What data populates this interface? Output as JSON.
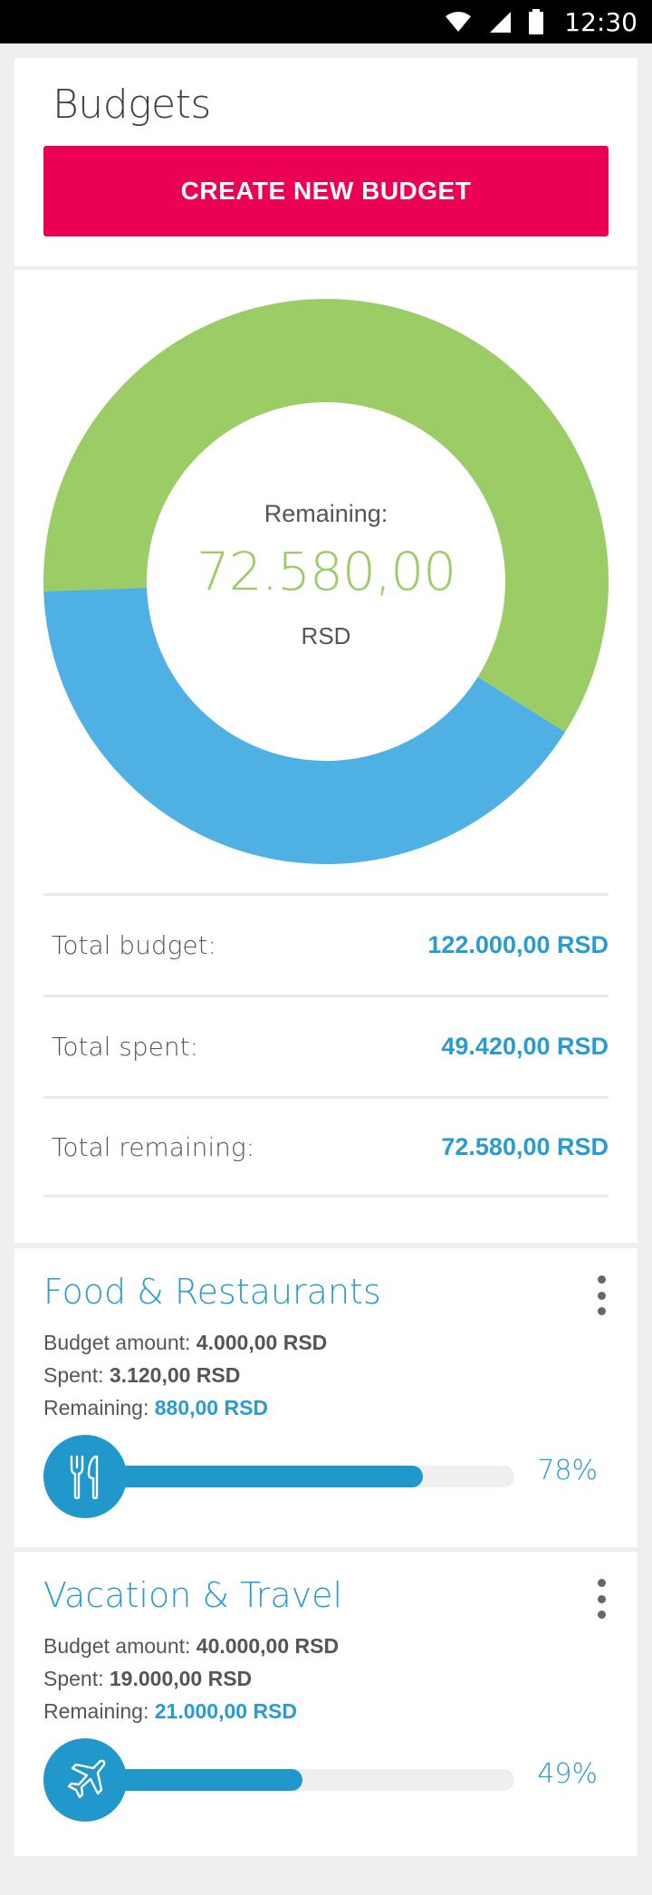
{
  "status_bar": {
    "time": "12:30",
    "icons": [
      "wifi-icon",
      "signal-icon",
      "battery-icon"
    ]
  },
  "page": {
    "title": "Budgets",
    "create_button": "CREATE NEW BUDGET"
  },
  "colors": {
    "accent": "#ec0055",
    "blue": "#2a9bd0",
    "green": "#9ccc65",
    "chart_blue": "#4fb0e3"
  },
  "chart_data": {
    "type": "pie",
    "series": [
      {
        "name": "",
        "value": 72580,
        "color": "#9ccc65"
      },
      {
        "name": "",
        "value": 49420,
        "color": "#4fb0e3"
      }
    ],
    "center": {
      "label": "Remaining:",
      "value": "72.580,00",
      "unit": "RSD"
    }
  },
  "totals": [
    {
      "label": "Total budget:",
      "value": "122.000,00 RSD"
    },
    {
      "label": "Total spent:",
      "value": "49.420,00 RSD"
    },
    {
      "label": "Total remaining:",
      "value": "72.580,00 RSD"
    }
  ],
  "budgets": [
    {
      "title": "Food & Restaurants",
      "amount_label": "Budget amount:",
      "amount": "4.000,00 RSD",
      "spent_label": "Spent:",
      "spent": "3.120,00 RSD",
      "remaining_label": "Remaining:",
      "remaining": "880,00 RSD",
      "icon": "fork-knife-icon",
      "progress": 0.78,
      "percent": "78%"
    },
    {
      "title": "Vacation & Travel",
      "amount_label": "Budget amount:",
      "amount": "40.000,00 RSD",
      "spent_label": "Spent:",
      "spent": "19.000,00 RSD",
      "remaining_label": "Remaining:",
      "remaining": "21.000,00 RSD",
      "icon": "airplane-icon",
      "progress": 0.49,
      "percent": "49%"
    }
  ]
}
